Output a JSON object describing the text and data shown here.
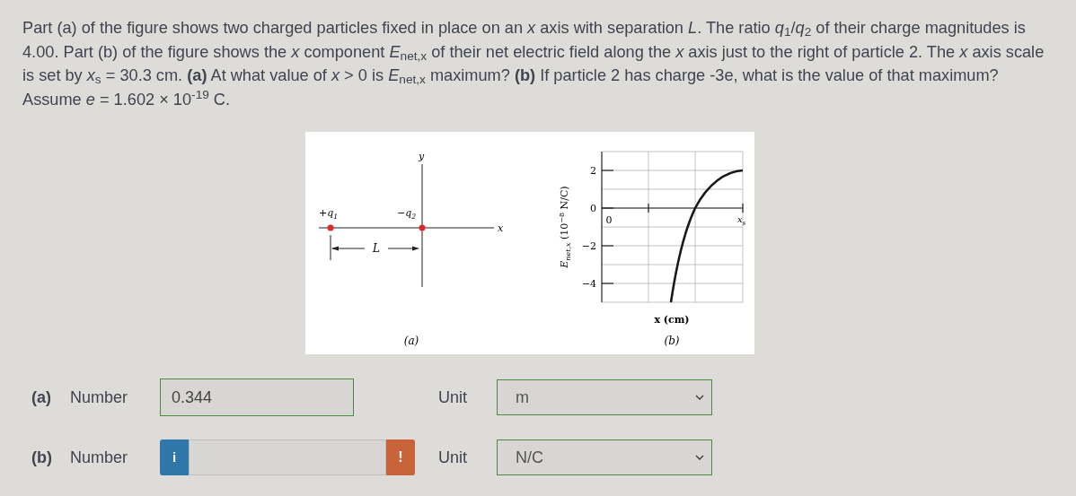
{
  "question": "Part (a) of the figure shows two charged particles fixed in place on an *x* axis with separation *L*. The ratio *q*$_{1}$/*q*$_{2}$ of their charge magnitudes is 4.00. Part (b) of the figure shows the *x* component *E*$_{net,x}$ of their net electric field along the *x* axis just to the right of particle 2. The *x* axis scale is set by *x*$_{s}$ = 30.3 cm. **(a)** At what value of *x* > 0 is *E*$_{net,x}$ maximum? **(b)** If particle 2 has charge -3e, what is the value of that maximum? Assume *e* = 1.602 × 10$^{-19}$ C.",
  "figure": {
    "part_a": {
      "y_axis": "y",
      "x_axis": "x",
      "charge_1": {
        "text": "+q",
        "subscript": "1"
      },
      "charge_2": {
        "text": "−q",
        "subscript": "2"
      },
      "separation": "L",
      "caption": "(a)"
    },
    "part_b": {
      "y_ticks": [
        "2",
        "0",
        "−2",
        "−4"
      ],
      "axis_label": {
        "symbol": "E",
        "subscript": "net,x",
        "before": " (10",
        "exponent": "−8",
        "after": " N/C)"
      },
      "origin": "0",
      "end_label": {
        "text": "x",
        "subscript": "s"
      },
      "x_label": "x (cm)",
      "caption": "(b)"
    }
  },
  "answers": [
    {
      "part": "(a)",
      "label": "Number",
      "value": "0.344",
      "graded": true,
      "kind": "plain",
      "unit_label": "Unit",
      "unit": "m",
      "unit_graded": true
    },
    {
      "part": "(b)",
      "label": "Number",
      "info": "i",
      "alert": "!",
      "graded": false,
      "kind": "hinted",
      "unit_label": "Unit",
      "unit": "N/C",
      "unit_graded": true
    }
  ]
}
